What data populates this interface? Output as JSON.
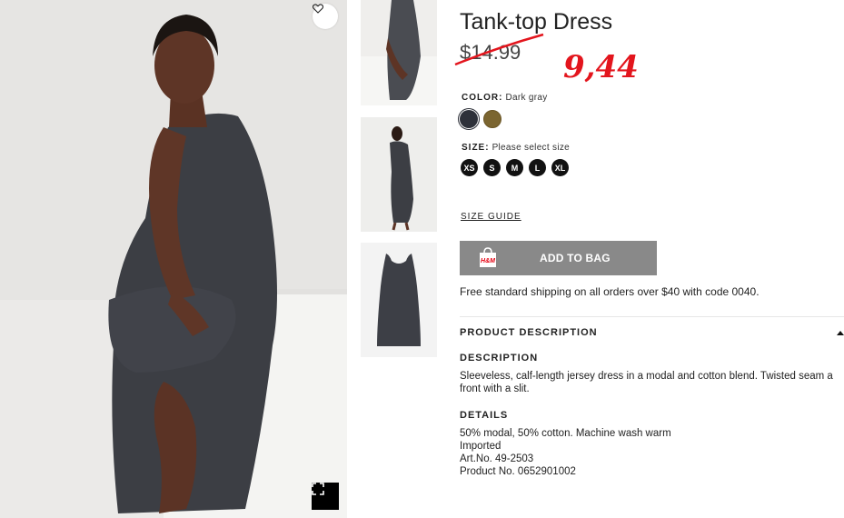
{
  "product": {
    "title": "Tank-top Dress",
    "old_price": "$14.99",
    "new_price_annotation": "9,44"
  },
  "color": {
    "label": "COLOR:",
    "selected": "Dark gray",
    "swatches": [
      "#2e313a",
      "#7b6530"
    ]
  },
  "size": {
    "label": "SIZE:",
    "prompt": "Please select size",
    "options": [
      "XS",
      "S",
      "M",
      "L",
      "XL"
    ]
  },
  "size_guide": "SIZE GUIDE",
  "add_to_bag": {
    "label": "ADD TO BAG",
    "icon_logo": "H&M"
  },
  "shipping_note": "Free standard shipping on all orders over $40 with code 0040.",
  "product_description": {
    "heading": "PRODUCT DESCRIPTION",
    "description_heading": "DESCRIPTION",
    "description_lines": [
      "Sleeveless, calf-length jersey dress in a modal and cotton blend. Twisted seam a",
      "front with a slit."
    ],
    "details_heading": "DETAILS",
    "details_lines": [
      "50% modal, 50% cotton. Machine wash warm",
      "Imported",
      "Art.No. 49-2503",
      "Product No. 0652901002"
    ]
  },
  "icons": {
    "favorite": "heart-icon",
    "fullscreen": "fullscreen-icon",
    "bag": "shopping-bag-icon",
    "toggle": "caret-up-icon"
  },
  "colors": {
    "price_annotation": "#e3151d",
    "add_to_bag_bg": "#898989"
  }
}
